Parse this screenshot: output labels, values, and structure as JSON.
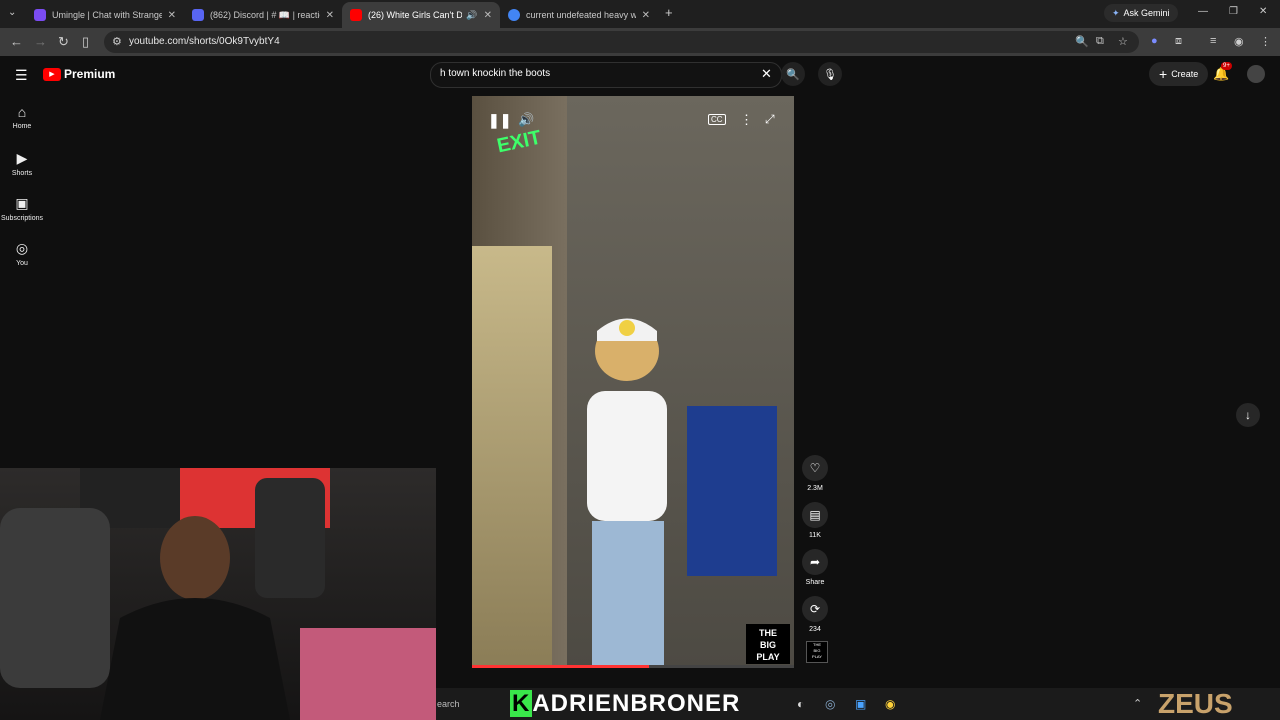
{
  "browser": {
    "tabs": [
      {
        "title": "Umingle | Chat with Strangers |",
        "color": "#7b4cf2"
      },
      {
        "title": "(862) Discord | # 📖 | reactions",
        "color": "#5865f2"
      },
      {
        "title": "(26) White Girls Can't Danc",
        "color": "#ff0000",
        "active": true
      },
      {
        "title": "current undefeated heavy weig",
        "color": "#4285f4"
      }
    ],
    "ask_gemini": "Ask Gemini",
    "url": "youtube.com/shorts/0Ok9TvybtY4"
  },
  "youtube": {
    "logo_text": "Premium",
    "search_value": "h town knockin the boots",
    "create_label": "Create",
    "notification_badge": "9+",
    "sidebar": [
      {
        "label": "Home",
        "icon": "home-icon"
      },
      {
        "label": "Shorts",
        "icon": "shorts-icon"
      },
      {
        "label": "Subscriptions",
        "icon": "subscriptions-icon"
      },
      {
        "label": "You",
        "icon": "you-icon"
      }
    ]
  },
  "short": {
    "exit_sign": "EXIT",
    "watermark_lines": [
      "THE",
      "BIG",
      "PLAY"
    ],
    "progress": 0.55,
    "actions": [
      {
        "name": "like",
        "label": "2.3M",
        "icon": "heart-icon"
      },
      {
        "name": "comments",
        "label": "11K",
        "icon": "comment-icon"
      },
      {
        "name": "share",
        "label": "Share",
        "icon": "share-icon"
      },
      {
        "name": "remix",
        "label": "234",
        "icon": "remix-icon"
      }
    ]
  },
  "overlay": {
    "ticker_first": "K",
    "ticker_rest": "ADRIENBRONER",
    "taskbar_search": "earch",
    "watermark": "ZEUS"
  },
  "colors": {
    "yt_red": "#ff0000",
    "ticker_green": "#39e64a",
    "bg": "#0f0f0f"
  }
}
